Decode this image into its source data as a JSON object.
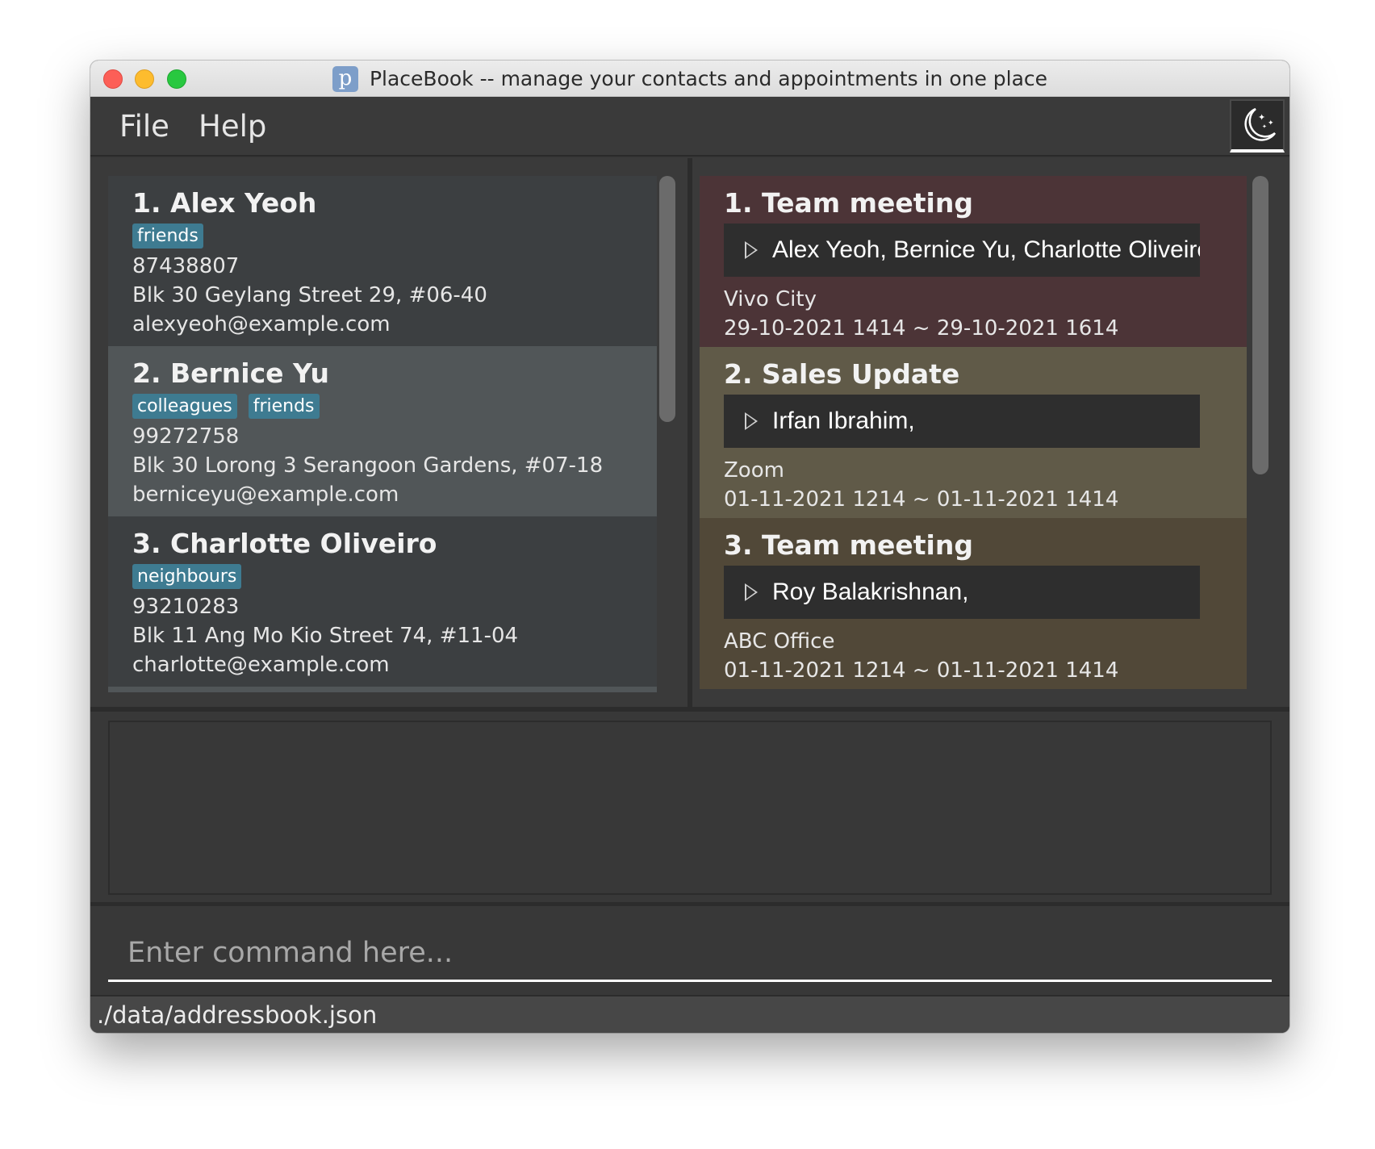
{
  "window": {
    "title": "PlaceBook -- manage your contacts and appointments in one place",
    "app_icon_letter": "p"
  },
  "menu": {
    "file": "File",
    "help": "Help"
  },
  "theme_toggle": {
    "icon": "moon-stars-icon"
  },
  "persons": [
    {
      "title": "1.  Alex Yeoh",
      "tags": [
        "friends"
      ],
      "phone": "87438807",
      "address": "Blk 30 Geylang Street 29, #06-40",
      "email": "alexyeoh@example.com"
    },
    {
      "title": "2.  Bernice Yu",
      "tags": [
        "colleagues",
        "friends"
      ],
      "phone": "99272758",
      "address": "Blk 30 Lorong 3 Serangoon Gardens, #07-18",
      "email": "berniceyu@example.com"
    },
    {
      "title": "3.  Charlotte Oliveiro",
      "tags": [
        "neighbours"
      ],
      "phone": "93210283",
      "address": "Blk 11 Ang Mo Kio Street 74, #11-04",
      "email": "charlotte@example.com"
    }
  ],
  "appointments": [
    {
      "title": "1.  Team meeting",
      "participants": "Alex Yeoh, Bernice Yu, Charlotte Oliveiro,",
      "location": "Vivo City",
      "time": "29-10-2021 1414  ~  29-10-2021 1614",
      "color": "#4c3437"
    },
    {
      "title": "2.  Sales Update",
      "participants": "Irfan Ibrahim,",
      "location": "Zoom",
      "time": "01-11-2021 1214  ~  01-11-2021 1414",
      "color": "#605a48"
    },
    {
      "title": "3.  Team meeting",
      "participants": "Roy Balakrishnan,",
      "location": "ABC Office",
      "time": "01-11-2021 1214  ~  01-11-2021 1414",
      "color": "#514838"
    }
  ],
  "command": {
    "placeholder": "Enter command here..."
  },
  "status": {
    "path": "./data/addressbook.json"
  }
}
